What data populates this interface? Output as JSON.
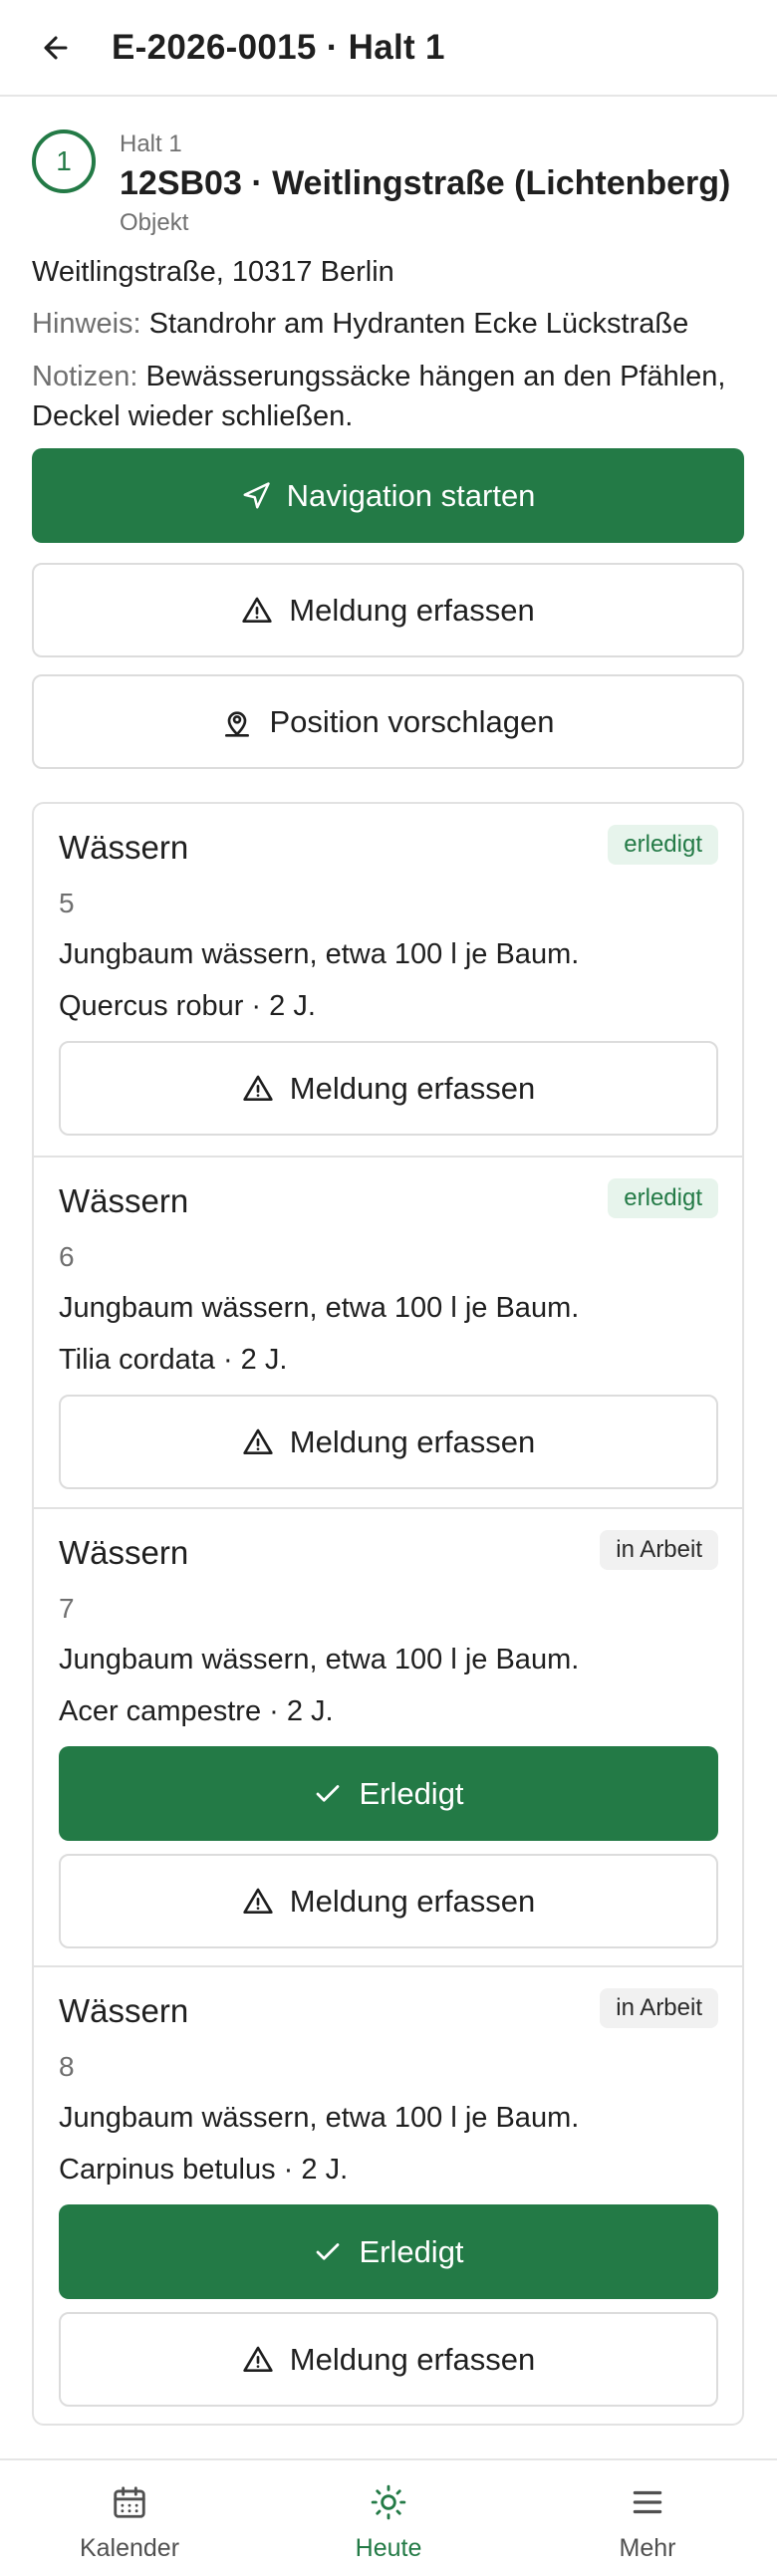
{
  "header": {
    "title": "E-2026-0015 · Halt 1"
  },
  "stop": {
    "number": "1",
    "kicker": "Halt 1",
    "name": "12SB03 · Weitlingstraße (Lichtenberg)",
    "type": "Objekt",
    "address": "Weitlingstraße, 10317 Berlin",
    "hint_label": "Hinweis:",
    "hint_text": "Standrohr am Hydranten Ecke Lückstraße",
    "notes_label": "Notizen:",
    "notes_line1": "Bewässerungssäcke hängen an den Pfählen,",
    "notes_line2": "Deckel wieder schließen."
  },
  "actions": {
    "navigate": "Navigation starten",
    "report": "Meldung erfassen",
    "suggest_position": "Position vorschlagen"
  },
  "tasks": [
    {
      "title": "Wässern",
      "status": "erledigt",
      "number": "5",
      "description": "Jungbaum wässern, etwa 100 l je Baum.",
      "species": "Quercus robur · 2 J.",
      "report_label": "Meldung erfassen"
    },
    {
      "title": "Wässern",
      "status": "erledigt",
      "number": "6",
      "description": "Jungbaum wässern, etwa 100 l je Baum.",
      "species": "Tilia cordata · 2 J.",
      "report_label": "Meldung erfassen"
    },
    {
      "title": "Wässern",
      "status": "in Arbeit",
      "number": "7",
      "description": "Jungbaum wässern, etwa 100 l je Baum.",
      "species": "Acer campestre · 2 J.",
      "done_label": "Erledigt",
      "report_label": "Meldung erfassen"
    },
    {
      "title": "Wässern",
      "status": "in Arbeit",
      "number": "8",
      "description": "Jungbaum wässern, etwa 100 l je Baum.",
      "species": "Carpinus betulus · 2 J.",
      "done_label": "Erledigt",
      "report_label": "Meldung erfassen"
    }
  ],
  "nav": {
    "items": [
      {
        "label": "Kalender",
        "icon": "calendar-icon"
      },
      {
        "label": "Heute",
        "icon": "sun-icon",
        "active": true
      },
      {
        "label": "Mehr",
        "icon": "menu-icon"
      }
    ]
  },
  "colors": {
    "accent": "#237a46",
    "badge_done_bg": "#e7f4ec",
    "badge_work_bg": "#f1f1f1"
  }
}
